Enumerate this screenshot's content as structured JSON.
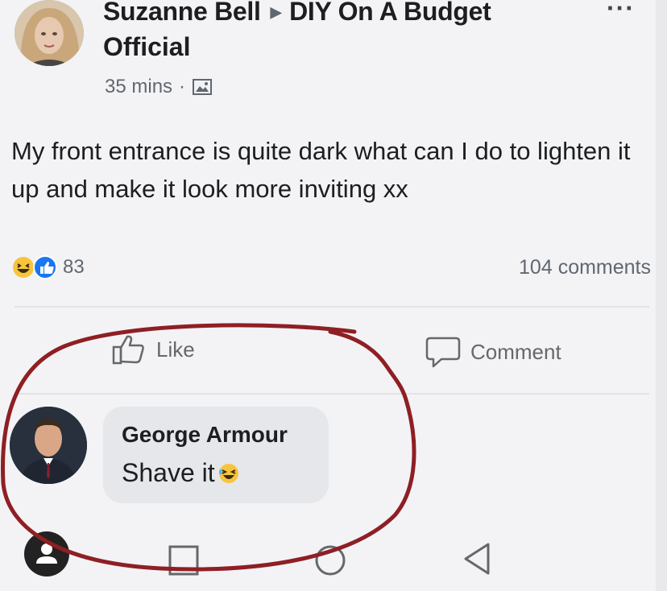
{
  "post": {
    "author": "Suzanne Bell",
    "group_line1": "DIY On A Budget",
    "group_line2": "Official",
    "time": "35 mins",
    "separator": "·",
    "text": "My front entrance is quite dark what can I do to lighten it up and make it look more inviting xx",
    "reaction_count": "83",
    "comment_count": "104 comments",
    "more_menu": "···"
  },
  "actions": {
    "like_label": "Like",
    "comment_label": "Comment"
  },
  "comment": {
    "author": "George Armour",
    "text": "Shave it"
  },
  "icons": {
    "audience": "photo-icon",
    "like": "thumbs-up-icon",
    "comment": "speech-bubble-icon",
    "reactions": [
      "haha-icon",
      "like-reaction-icon"
    ],
    "emoji": "laughing-emoji-icon",
    "navigation": [
      "square-icon",
      "circle-icon",
      "back-triangle-icon"
    ],
    "account": "account-icon"
  },
  "colors": {
    "annotation_circle": "#8e1f24",
    "secondary_text": "#606770",
    "like_blue": "#1877f2"
  }
}
